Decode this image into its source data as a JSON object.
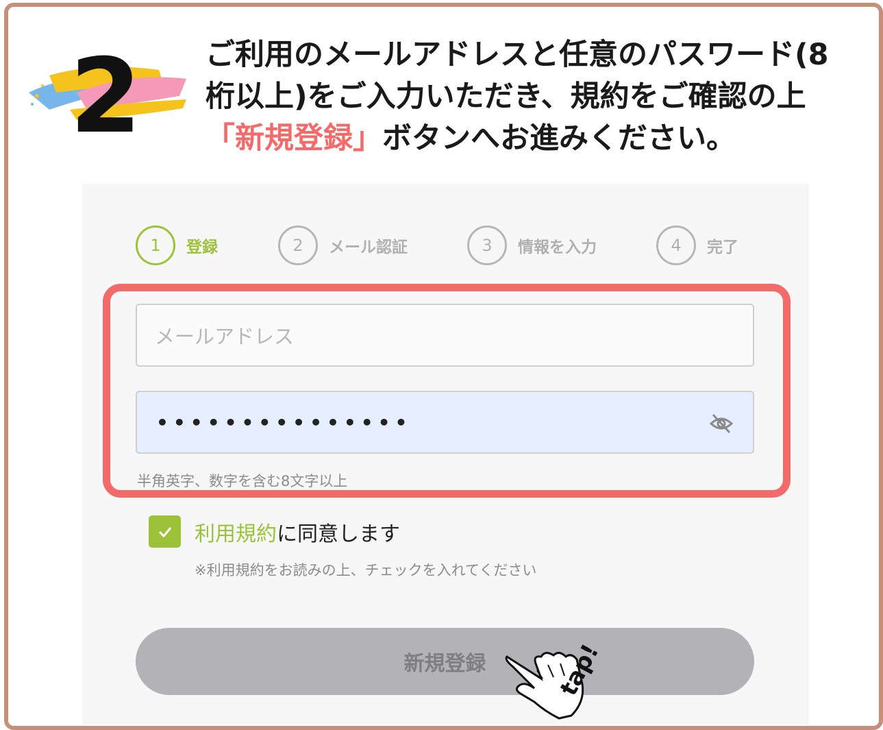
{
  "step_number": "2",
  "instruction": {
    "line1": "ご利用のメールアドレスと任意のパスワード(8",
    "line2": "桁以上)をご入力いただき、規約をご確認の上",
    "line3_highlight": "「新規登録」",
    "line3_rest": "ボタンへお進みください。"
  },
  "steps": [
    {
      "number": "1",
      "label": "登録",
      "active": true
    },
    {
      "number": "2",
      "label": "メール認証",
      "active": false
    },
    {
      "number": "3",
      "label": "情報を入力",
      "active": false
    },
    {
      "number": "4",
      "label": "完了",
      "active": false
    }
  ],
  "form": {
    "email_placeholder": "メールアドレス",
    "password_value": "•••••••••••••••",
    "password_hint": "半角英字、数字を含む8文字以上",
    "agree_link": "利用規約",
    "agree_text": "に同意します",
    "agree_checked": true,
    "agree_note": "※利用規約をお読みの上、チェックを入れてください",
    "submit_label": "新規登録"
  },
  "tap_label": "tap!",
  "colors": {
    "frame": "#c4907b",
    "accent_green": "#9cc23a",
    "highlight_red": "#f26a6a",
    "button_gray": "#b3b2b7"
  }
}
